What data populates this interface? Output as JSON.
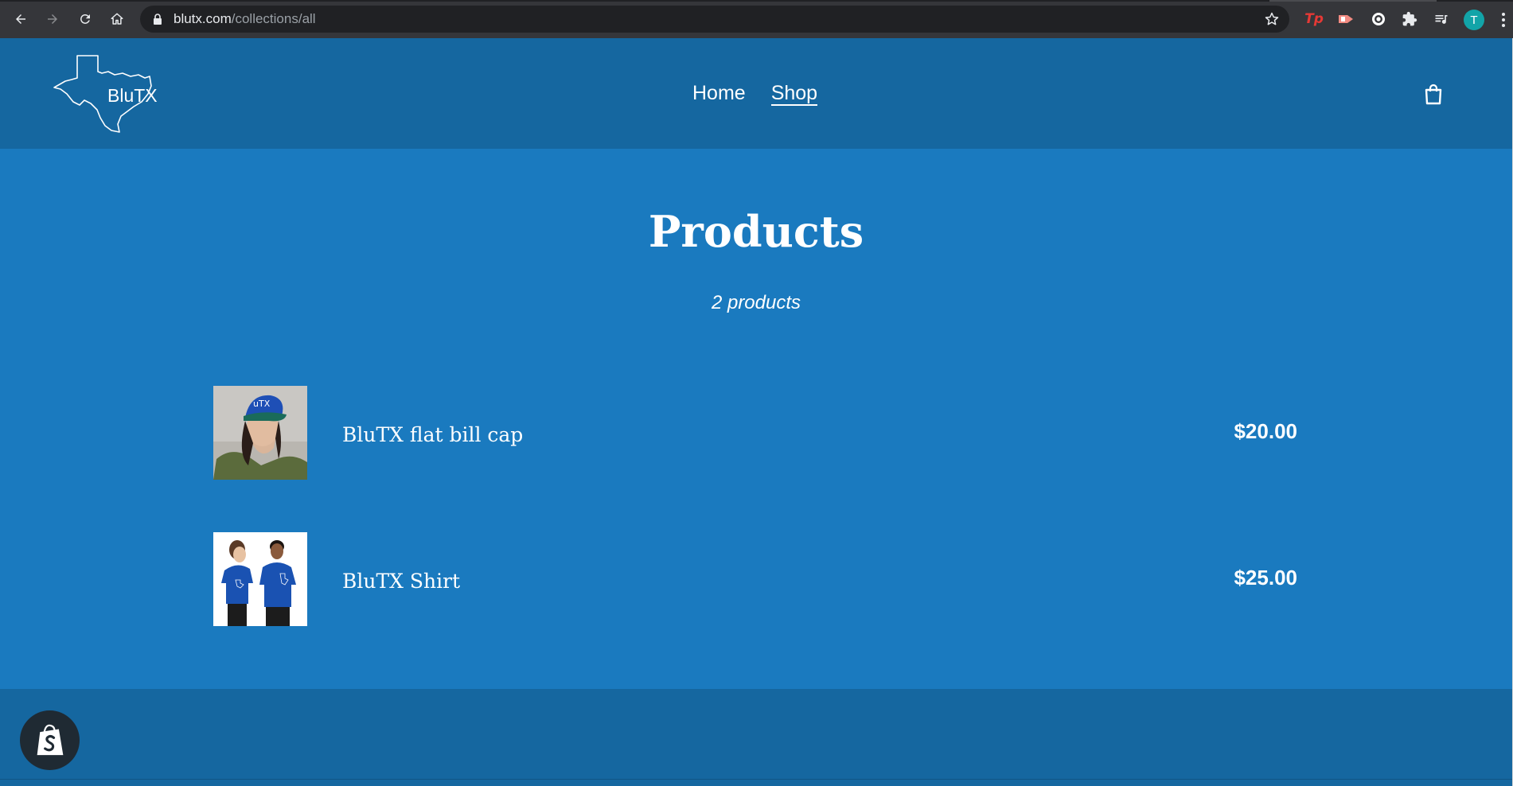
{
  "browser": {
    "url_host": "blutx.com",
    "url_path": "/collections/all",
    "profile_initial": "T",
    "extension_tp_label": "Tp"
  },
  "header": {
    "logo_text": "BluTX",
    "nav": [
      {
        "label": "Home",
        "active": false
      },
      {
        "label": "Shop",
        "active": true
      }
    ]
  },
  "main": {
    "title": "Products",
    "count": "2 products",
    "products": [
      {
        "name": "BluTX flat bill cap",
        "price": "$20.00",
        "image": "cap-photo"
      },
      {
        "name": "BluTX Shirt",
        "price": "$25.00",
        "image": "shirt-photo"
      }
    ]
  },
  "colors": {
    "header_bg": "#1567a0",
    "page_bg": "#1a7abf",
    "footer_bg": "#1567a0",
    "text": "#ffffff"
  }
}
